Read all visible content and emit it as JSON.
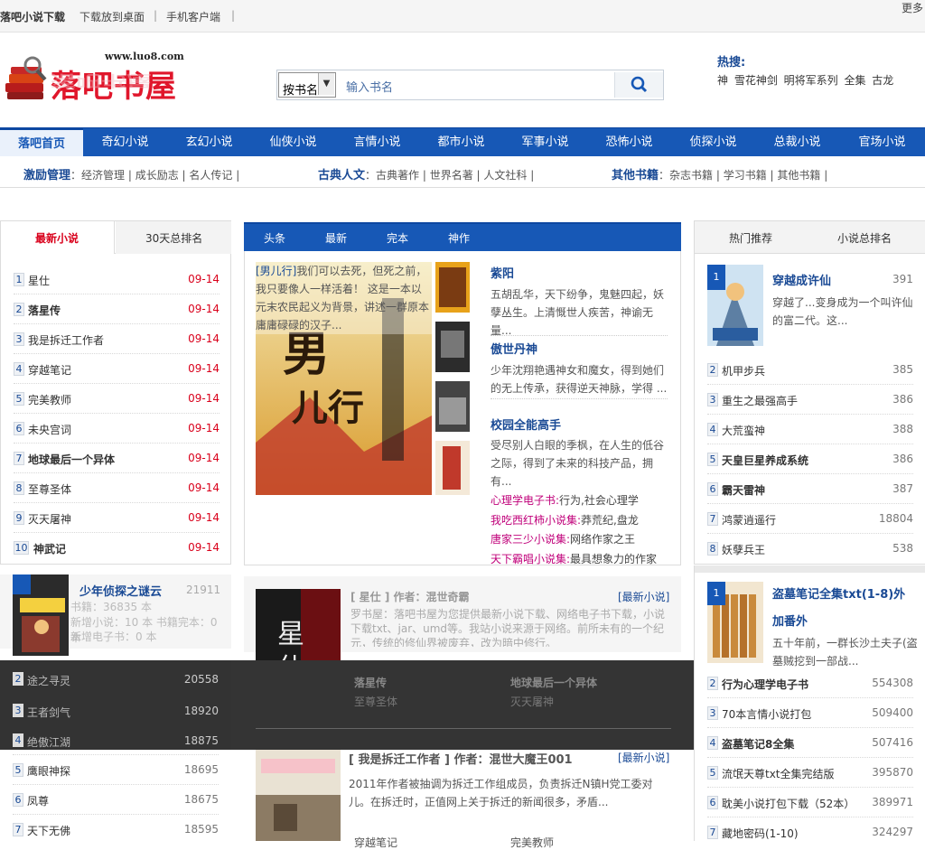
{
  "topbar": {
    "brand": "落吧小说下载",
    "links": [
      "下载放到桌面",
      "手机客户端"
    ],
    "more": "更多"
  },
  "logo": {
    "url": "www.luo8.com",
    "name": "落吧书屋"
  },
  "search": {
    "select": "按书名",
    "placeholder": "输入书名"
  },
  "hot": {
    "title": "热搜:",
    "items": "神 雪花神剑 明将军系列 全集 古龙"
  },
  "nav": [
    "落吧首页",
    "奇幻小说",
    "玄幻小说",
    "仙侠小说",
    "言情小说",
    "都市小说",
    "军事小说",
    "恐怖小说",
    "侦探小说",
    "总裁小说",
    "官场小说"
  ],
  "subnav": [
    {
      "title": "激励管理",
      "text": "经济管理 | 成长励志 | 名人传记 |"
    },
    {
      "title": "古典人文",
      "text": "古典著作 | 世界名著 | 人文社科 |"
    },
    {
      "title": "其他书籍",
      "text": "杂志书籍 | 学习书籍 | 其他书籍 |"
    }
  ],
  "left_panel": {
    "tabs": [
      "最新小说",
      "30天总排名"
    ],
    "items": [
      {
        "n": "1",
        "t": "星仕",
        "d": "09-14"
      },
      {
        "n": "2",
        "t": "落星传",
        "d": "09-14"
      },
      {
        "n": "3",
        "t": "我是拆迁工作者",
        "d": "09-14"
      },
      {
        "n": "4",
        "t": "穿越笔记",
        "d": "09-14"
      },
      {
        "n": "5",
        "t": "完美教师",
        "d": "09-14"
      },
      {
        "n": "6",
        "t": "未央宫词",
        "d": "09-14"
      },
      {
        "n": "7",
        "t": "地球最后一个异体",
        "d": "09-14"
      },
      {
        "n": "8",
        "t": "至尊圣体",
        "d": "09-14"
      },
      {
        "n": "9",
        "t": "灭天屠神",
        "d": "09-14"
      },
      {
        "n": "10",
        "t": "神武记",
        "d": "09-14"
      }
    ]
  },
  "left_rank2": {
    "top": {
      "n": "1",
      "t": "少年侦探之谜云",
      "v": "21911",
      "stats": "书籍：36835 本",
      "stats2": "新增小说：10 本 书籍完本：0 本",
      "stats3": "新增电子书：0 本"
    },
    "items": [
      {
        "n": "2",
        "t": "途之寻灵",
        "v": "20558"
      },
      {
        "n": "3",
        "t": "王者剑气",
        "v": "18920"
      },
      {
        "n": "4",
        "t": "绝傲江湖",
        "v": "18875"
      },
      {
        "n": "5",
        "t": "鹰眼神探",
        "v": "18695"
      },
      {
        "n": "6",
        "t": "凤尊",
        "v": "18675"
      },
      {
        "n": "7",
        "t": "天下无佛",
        "v": "18595"
      }
    ]
  },
  "center": {
    "tabs": [
      "头条",
      "最新",
      "完本",
      "神作"
    ],
    "feature": {
      "tag": "[男儿行]",
      "desc": "我们可以去死，但死之前，我只要像人一样活着！ 这是一本以元末农民起义为背景，讲述一群原本庸庸碌碌的汉子..."
    },
    "books": [
      {
        "t": "紫阳",
        "d": "五胡乱华，天下纷争，鬼魅四起，妖孽丛生。上清慨世人疾苦，神谕无量..."
      },
      {
        "t": "傲世丹神",
        "d": "少年沈翔艳遇神女和魔女，得到她们的无上传承，获得逆天神脉，学得 ..."
      },
      {
        "t": "校园全能高手",
        "d": "受尽别人白眼的季枫，在人生的低谷之际，得到了未来的科技产品，拥有..."
      }
    ],
    "cats": [
      {
        "k": "心理学电子书:",
        "v": "行为,社会心理学"
      },
      {
        "k": "我吃西红柿小说集:",
        "v": "莽荒纪,盘龙"
      },
      {
        "k": "唐家三少小说集:",
        "v": "网络作家之王"
      },
      {
        "k": "天下霸唱小说集:",
        "v": "最具想象力的作家"
      }
    ],
    "news1": {
      "head": "[ 星仕 ] 作者：混世奇霸",
      "link": "[最新小说]",
      "desc": "罗书屋：落吧书屋为您提供最新小说下载、网络电子书下载，小说下载txt、jar、umd等。我站小说来源于网络。前所未有的一个纪元，传统的修仙界被废弃，改为暗中修行。"
    },
    "dark_books": [
      "落星传",
      "地球最后一个异体",
      "至尊圣体",
      "灭天屠神"
    ],
    "news2": {
      "head": "[ 我是拆迁工作者 ] 作者：混世大魔王001",
      "link": "[最新小说]",
      "desc": "2011年作者被抽调为拆迁工作组成员，负责拆迁N镇H党工委对儿。在拆迁时，正值网上关于拆迁的新闻很多，矛盾...",
      "more": [
        "穿越笔记",
        "完美教师"
      ]
    }
  },
  "right_panel": {
    "tabs": [
      "热门推荐",
      "小说总排名"
    ],
    "top": {
      "n": "1",
      "t": "穿越成许仙",
      "v": "391",
      "d": "穿越了...变身成为一个叫许仙的富二代。这..."
    },
    "items": [
      {
        "n": "2",
        "t": "机甲步兵",
        "v": "385"
      },
      {
        "n": "3",
        "t": "重生之最强高手",
        "v": "386"
      },
      {
        "n": "4",
        "t": "大荒蛮神",
        "v": "388"
      },
      {
        "n": "5",
        "t": "天皇巨星养成系统",
        "v": "386",
        "b": true
      },
      {
        "n": "6",
        "t": "霸天雷神",
        "v": "387",
        "b": true
      },
      {
        "n": "7",
        "t": "鸿蒙逍遥行",
        "v": "18804"
      },
      {
        "n": "8",
        "t": "妖孽兵王",
        "v": "538"
      }
    ]
  },
  "right_rank2": {
    "top": {
      "n": "1",
      "t": "盗墓笔记全集txt(1-8)外加番外",
      "d": "五十年前，一群长沙土夫子(盗墓贼挖到一部战..."
    },
    "items": [
      {
        "n": "2",
        "t": "行为心理学电子书",
        "v": "554308",
        "b": true
      },
      {
        "n": "3",
        "t": "70本言情小说打包",
        "v": "509400"
      },
      {
        "n": "4",
        "t": "盗墓笔记8全集",
        "v": "507416",
        "b": true
      },
      {
        "n": "5",
        "t": "流氓天尊txt全集完结版",
        "v": "395870"
      },
      {
        "n": "6",
        "t": "耽美小说打包下载（52本）",
        "v": "389971"
      },
      {
        "n": "7",
        "t": "藏地密码(1-10)",
        "v": "324297"
      }
    ]
  }
}
